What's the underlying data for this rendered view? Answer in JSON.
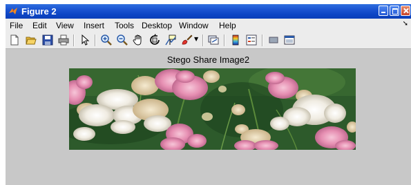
{
  "window": {
    "title": "Figure 2"
  },
  "menu": {
    "items": [
      "File",
      "Edit",
      "View",
      "Insert",
      "Tools",
      "Desktop",
      "Window",
      "Help"
    ]
  },
  "toolbar": {
    "icons": [
      "new-figure-icon",
      "open-file-icon",
      "save-icon",
      "print-icon",
      "select-arrow-icon",
      "zoom-in-icon",
      "zoom-out-icon",
      "pan-hand-icon",
      "rotate-3d-icon",
      "data-cursor-icon",
      "brush-icon",
      "link-plot-icon",
      "colorbar-icon",
      "legend-icon",
      "hide-plot-tools-icon",
      "show-plot-tools-icon"
    ]
  },
  "axes": {
    "title": "Stego Share Image2"
  },
  "colors": {
    "titlebar": "#0d45c5",
    "figure_background": "#c8c8c8",
    "foliage": "#2c5a2a",
    "pink_flowers": "#e58fb0",
    "white_flowers": "#f3efe8"
  }
}
